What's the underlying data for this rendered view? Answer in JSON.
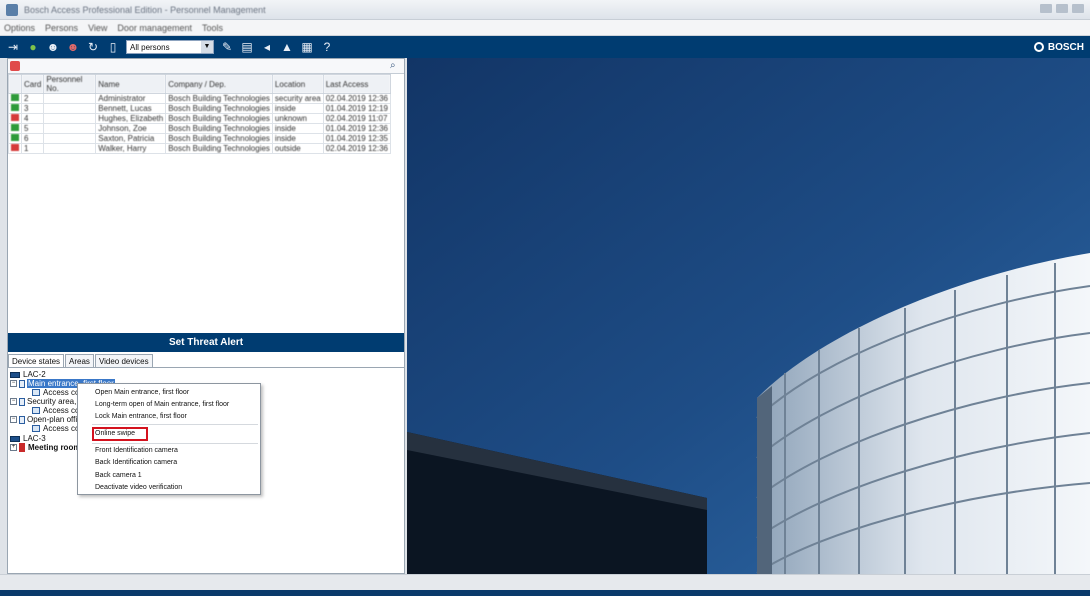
{
  "window": {
    "title": "Bosch Access Professional Edition - Personnel Management",
    "min_icon": "minimize-icon",
    "max_icon": "maximize-icon",
    "close_icon": "close-icon"
  },
  "menu": {
    "items": [
      "Options",
      "Persons",
      "View",
      "Door management",
      "Tools"
    ]
  },
  "toolbar": {
    "combo_value": "All persons",
    "brand": "BOSCH",
    "colors": {
      "bar": "#003c71",
      "accent_green": "#7fc24a",
      "accent_red": "#e06a6a"
    }
  },
  "persons_table": {
    "columns": [
      "",
      "Card",
      "Personnel No.",
      "Name",
      "Company / Dep.",
      "Location",
      "Last Access"
    ],
    "rows": [
      {
        "status": "green",
        "card": "2",
        "no": "",
        "name": "Administrator",
        "company": "Bosch Building Technologies",
        "location": "security area",
        "last": "02.04.2019 12:36"
      },
      {
        "status": "green",
        "card": "3",
        "no": "",
        "name": "Bennett, Lucas",
        "company": "Bosch Building Technologies",
        "location": "inside",
        "last": "01.04.2019 12:19"
      },
      {
        "status": "red",
        "card": "4",
        "no": "",
        "name": "Hughes, Elizabeth",
        "company": "Bosch Building Technologies",
        "location": "unknown",
        "last": "02.04.2019 11:07"
      },
      {
        "status": "green",
        "card": "5",
        "no": "",
        "name": "Johnson, Zoe",
        "company": "Bosch Building Technologies",
        "location": "inside",
        "last": "01.04.2019 12:36"
      },
      {
        "status": "green",
        "card": "6",
        "no": "",
        "name": "Saxton, Patricia",
        "company": "Bosch Building Technologies",
        "location": "inside",
        "last": "01.04.2019 12:35"
      },
      {
        "status": "red",
        "card": "1",
        "no": "",
        "name": "Walker, Harry",
        "company": "Bosch Building Technologies",
        "location": "outside",
        "last": "02.04.2019 12:36"
      }
    ]
  },
  "threat_alert": {
    "label": "Set Threat Alert"
  },
  "tabs": {
    "device_states": "Device states",
    "areas": "Areas",
    "video_devices": "Video devices"
  },
  "tree": {
    "lac2": "LAC-2",
    "main_entrance": "Main entrance, first floor",
    "access_con_1": "Access con",
    "security_area": "Security area, th",
    "access_con_2": "Access con",
    "open_plan": "Open-plan office",
    "access_con_3": "Access con",
    "lac3": "LAC-3",
    "meeting_room": "Meeting room"
  },
  "context_menu": {
    "open": "Open Main entrance, first floor",
    "long_term": "Long-term open of Main entrance, first floor",
    "lock": "Lock Main entrance, first floor",
    "online_swipe": "Online swipe",
    "front_camera": "Front Identification camera",
    "back_id_camera": "Back Identification camera",
    "back_camera": "Back camera 1",
    "deactivate": "Deactivate video verification"
  }
}
